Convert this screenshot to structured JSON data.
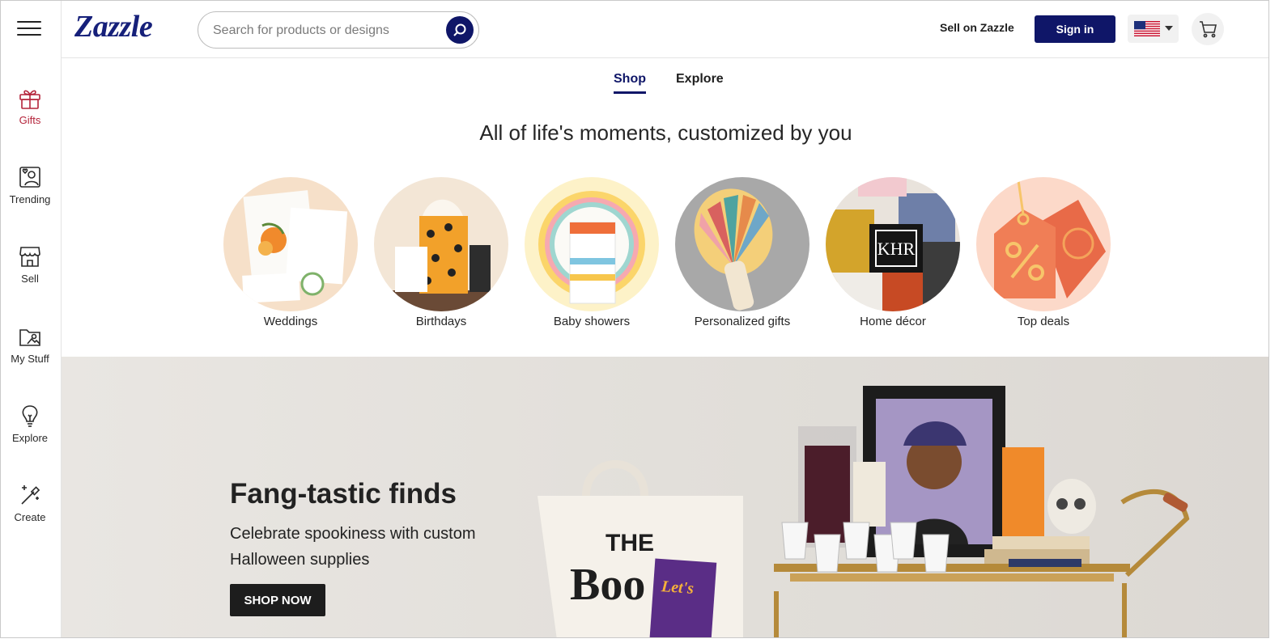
{
  "header": {
    "logo": "Zazzle",
    "search_placeholder": "Search for products or designs",
    "sell_label": "Sell on Zazzle",
    "signin_label": "Sign in"
  },
  "rail": {
    "items": [
      {
        "label": "Gifts",
        "icon": "gift-icon",
        "active": true
      },
      {
        "label": "Trending",
        "icon": "trending-icon"
      },
      {
        "label": "Sell",
        "icon": "storefront-icon"
      },
      {
        "label": "My Stuff",
        "icon": "folder-icon"
      },
      {
        "label": "Explore",
        "icon": "lightbulb-icon"
      },
      {
        "label": "Create",
        "icon": "magic-wand-icon"
      }
    ]
  },
  "tabs": [
    {
      "label": "Shop",
      "active": true
    },
    {
      "label": "Explore",
      "active": false
    }
  ],
  "headline": "All of life's moments, customized by you",
  "categories": [
    {
      "label": "Weddings"
    },
    {
      "label": "Birthdays"
    },
    {
      "label": "Baby showers"
    },
    {
      "label": "Personalized gifts"
    },
    {
      "label": "Home décor"
    },
    {
      "label": "Top deals"
    }
  ],
  "hero": {
    "title": "Fang-tastic finds",
    "subtitle": "Celebrate spookiness with custom Halloween supplies",
    "button": "SHOP NOW"
  },
  "colors": {
    "brand_navy": "#0f1668",
    "active_red": "#b4233a",
    "hero_button": "#1d1d1d"
  }
}
